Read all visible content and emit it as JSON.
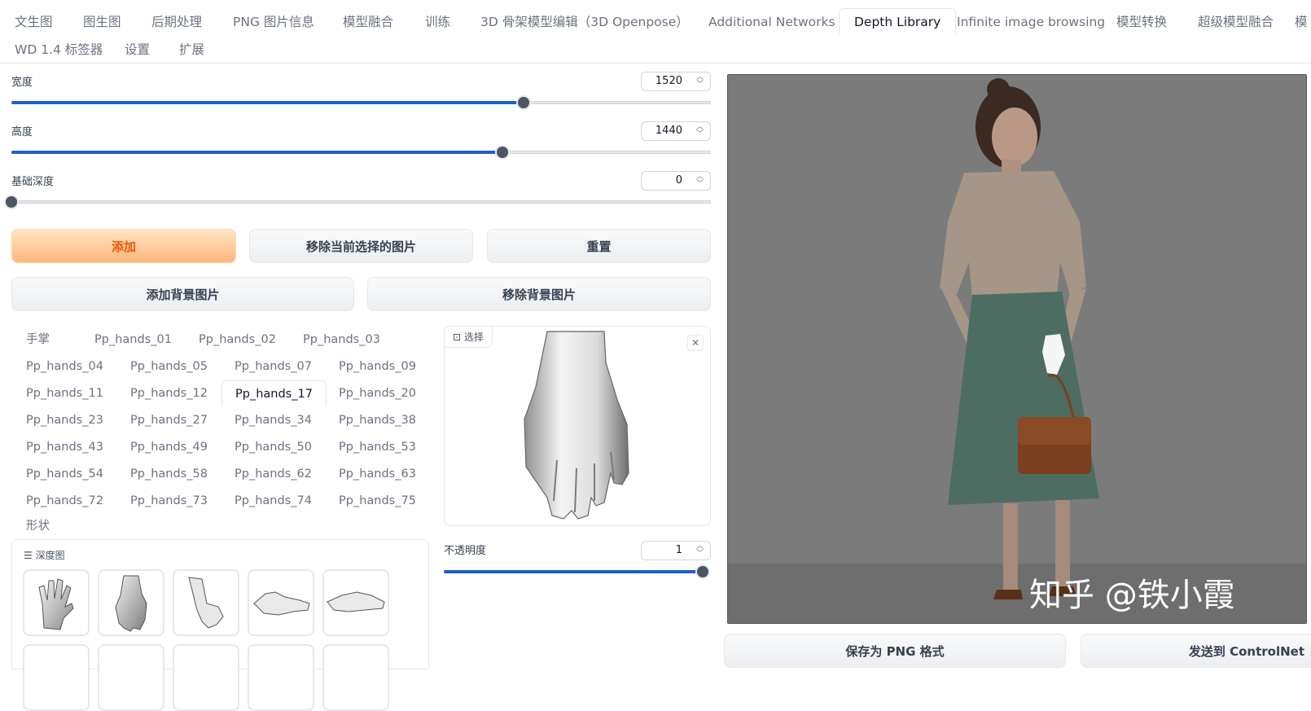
{
  "tabs_row1": [
    "文生图",
    "图生图",
    "后期处理",
    "PNG 图片信息",
    "模型融合",
    "训练",
    "3D 骨架模型编辑（3D Openpose）",
    "Additional Networks",
    "Depth Library",
    "Infinite image browsing",
    "模型转换",
    "超级模型融合",
    "模"
  ],
  "tabs_row2": [
    "WD 1.4 标签器",
    "设置",
    "扩展"
  ],
  "active_tab": "Depth Library",
  "sliders": {
    "width": {
      "label": "宽度",
      "value": "1520",
      "level": 0.732
    },
    "height": {
      "label": "高度",
      "value": "1440",
      "level": 0.702
    },
    "base_depth": {
      "label": "基础深度",
      "value": "0",
      "level": 0
    }
  },
  "buttons": {
    "add": "添加",
    "remove_selected": "移除当前选择的图片",
    "reset": "重置",
    "add_background": "添加背景图片",
    "remove_background": "移除背景图片",
    "save_png": "保存为 PNG 格式",
    "send_controlnet": "发送到 ControlNet"
  },
  "hand_categories": {
    "header": "手掌",
    "items": [
      "Pp_hands_01",
      "Pp_hands_02",
      "Pp_hands_03",
      "Pp_hands_04",
      "Pp_hands_05",
      "Pp_hands_07",
      "Pp_hands_09",
      "Pp_hands_11",
      "Pp_hands_12",
      "Pp_hands_17",
      "Pp_hands_20",
      "Pp_hands_23",
      "Pp_hands_27",
      "Pp_hands_34",
      "Pp_hands_38",
      "Pp_hands_43",
      "Pp_hands_49",
      "Pp_hands_50",
      "Pp_hands_53",
      "Pp_hands_54",
      "Pp_hands_58",
      "Pp_hands_62",
      "Pp_hands_63",
      "Pp_hands_72",
      "Pp_hands_73",
      "Pp_hands_74",
      "Pp_hands_75"
    ],
    "selected": "Pp_hands_17",
    "shape_label": "形状"
  },
  "depth_gallery": {
    "label": "深度图",
    "icon": "list-icon"
  },
  "preview": {
    "label": "选择",
    "icon": "image-icon",
    "close_icon": "close-icon"
  },
  "opacity": {
    "label": "不透明度",
    "value": "1",
    "level": 1.0
  },
  "watermark": "知乎 @铁小霞",
  "colors": {
    "accent": "#1d5fcf",
    "primary_button": "#fdb77a",
    "primary_text": "#ea580c"
  }
}
